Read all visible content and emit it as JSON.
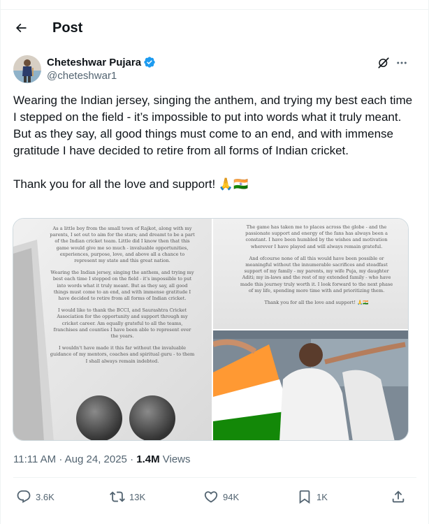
{
  "header": {
    "title": "Post"
  },
  "author": {
    "name": "Cheteshwar Pujara",
    "handle": "@cheteshwar1"
  },
  "tweet": {
    "text": "Wearing the Indian jersey, singing the anthem, and trying my best each time I stepped on the field - it’s impossible to put into words what it truly meant. But as they say, all good things must come to an end, and with immense gratitude I have decided to retire from all forms of Indian cricket.\n\nThank you for all the love and support! 🙏🇮🇳"
  },
  "media": {
    "left_paragraphs": [
      "As a little boy from the small town of Rajkot, along with my parents, I set out to aim for the stars; and dreamt to be a part of the Indian cricket team. Little did I know then that this game would give me so much - invaluable opportunities, experiences, purpose, love, and above all a chance to represent my state and this great nation.",
      "Wearing the Indian jersey, singing the anthem, and trying my best each time I stepped on the field - it's impossible to put into words what it truly meant. But as they say, all good things must come to an end, and with immense gratitude I have decided to retire from all forms of Indian cricket.",
      "I would like to thank the BCCI, and Saurashtra Cricket Association for the opportunity and support through my cricket career. Am equally grateful to all the teams, franchises and counties I have been able to represent over the years.",
      "I wouldn't have made it this far without the invaluable guidance of my mentors, coaches and spiritual guru - to them I shall always remain indebted."
    ],
    "right_paragraphs": [
      "The game has taken me to places across the globe - and the passionate support and energy of the fans has always been a constant. I have been humbled by the wishes and motivation wherever I have played and will always remain grateful.",
      "And ofcourse none of all this would have been possible or meaningful without the innumerable sacrifices and steadfast support of my family - my parents, my wife Puja, my daughter Aditi; my in-laws and the rest of my extended family - who have made this journey truly worth it. I look forward to the next phase of my life, spending more time with and prioritizing them.",
      "Thank you for all the love and support! 🙏🇮🇳"
    ]
  },
  "meta": {
    "time": "11:11 AM · Aug 24, 2025 · ",
    "views_count": "1.4M",
    "views_label": " Views"
  },
  "actions": {
    "replies": "3.6K",
    "reposts": "13K",
    "likes": "94K",
    "bookmarks": "1K"
  },
  "colors": {
    "accent": "#1d9bf0",
    "muted": "#536471",
    "text": "#0f1419",
    "border": "#eff3f4"
  },
  "icons": [
    "back-arrow-icon",
    "verified-badge-icon",
    "grok-icon",
    "more-icon",
    "reply-icon",
    "repost-icon",
    "like-icon",
    "bookmark-icon",
    "share-icon"
  ]
}
